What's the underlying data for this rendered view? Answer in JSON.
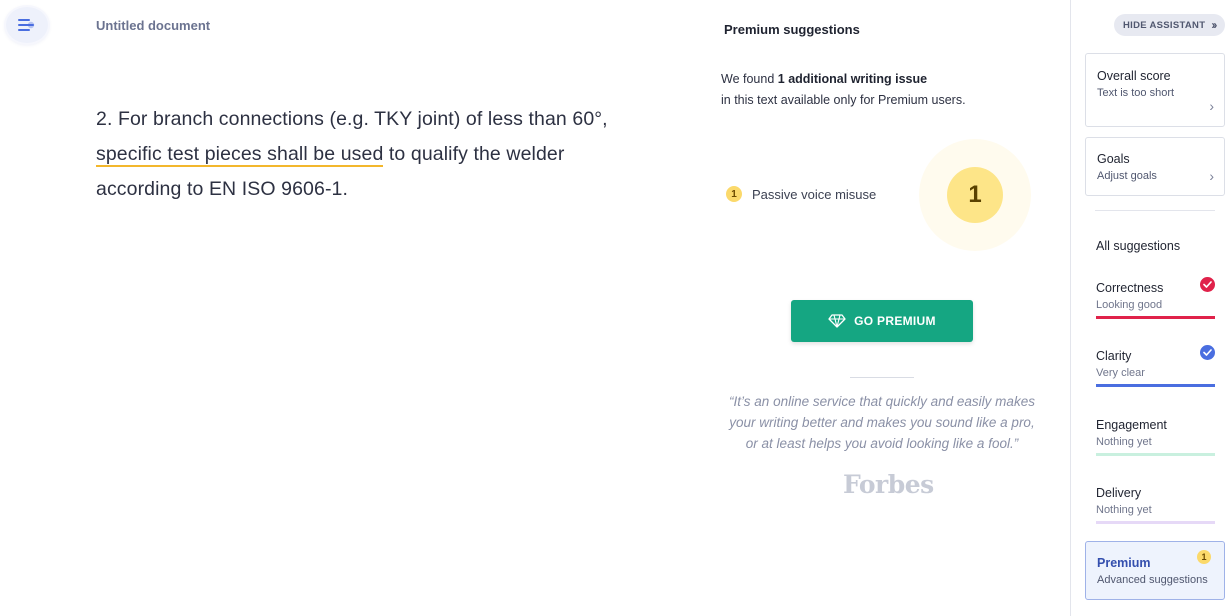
{
  "colors": {
    "accent_green": "#15a682",
    "highlight_underline": "#f3b72c",
    "correctness": "#e0224a",
    "clarity": "#4a6ee0",
    "engagement": "#c9f0df",
    "delivery": "#e6d9f7",
    "premium_badge": "#fbd96b"
  },
  "editor": {
    "document_title": "Untitled document",
    "menu_icon": "menu-icon",
    "text_before": "2. For branch connections (e.g. TKY joint) of less than 60°, ",
    "text_highlight": "specific test pieces shall be used",
    "text_after": " to qualify the welder according to EN ISO 9606-1."
  },
  "premium_panel": {
    "title": "Premium suggestions",
    "found_prefix": "We found ",
    "found_bold": "1 additional writing issue",
    "found_line2": "in this text available only for Premium users.",
    "issue_count": "1",
    "issue_label": "Passive voice misuse",
    "big_count": "1",
    "go_premium_label": "GO PREMIUM",
    "gem_icon": "diamond-icon",
    "quote_line1": "“It’s an online service that quickly and easily makes",
    "quote_line2": "your writing better and makes you sound like a pro,",
    "quote_line3": "or at least helps you avoid looking like a fool.”",
    "quote_source": "Forbes"
  },
  "sidebar": {
    "hide_label": "HIDE ASSISTANT",
    "hide_icon": "double-chevron-right-icon",
    "overall_title": "Overall score",
    "overall_sub": "Text is too short",
    "goals_title": "Goals",
    "goals_sub": "Adjust goals",
    "all_suggestions": "All suggestions",
    "categories": [
      {
        "name": "Correctness",
        "status": "Looking good"
      },
      {
        "name": "Clarity",
        "status": "Very clear"
      },
      {
        "name": "Engagement",
        "status": "Nothing yet"
      },
      {
        "name": "Delivery",
        "status": "Nothing yet"
      }
    ],
    "premium_title": "Premium",
    "premium_sub": "Advanced suggestions",
    "premium_count": "1"
  }
}
